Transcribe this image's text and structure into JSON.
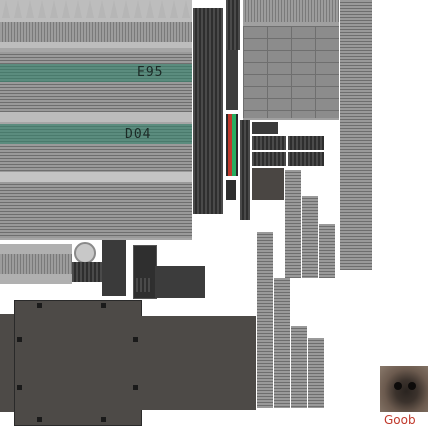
{
  "texture": {
    "panel_codes": [
      "E95",
      "D04"
    ],
    "artist_tag": "Goob"
  },
  "colors": {
    "teal": "#5b8c7e",
    "dark_metal": "#4d4a47",
    "red_stripe": "#c0392b",
    "green_stripe": "#27ae60",
    "tag_red": "#c0392b"
  }
}
